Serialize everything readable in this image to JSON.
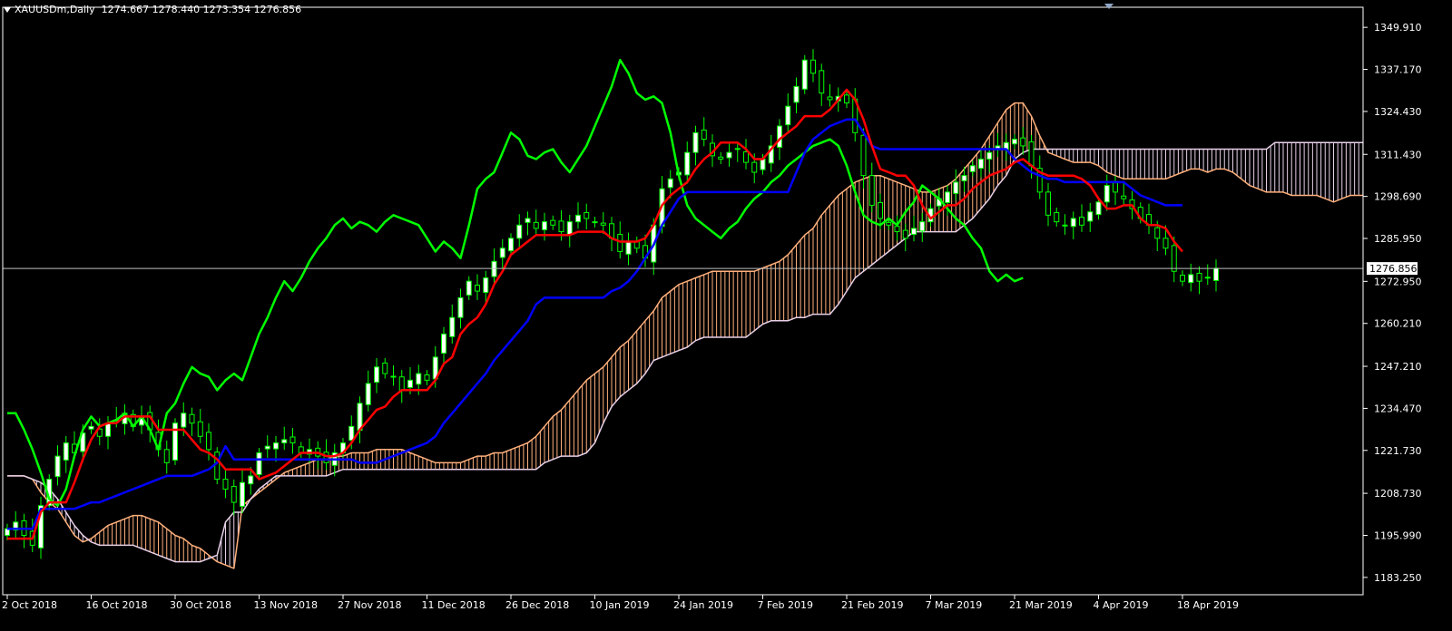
{
  "window": {
    "symbol_label": "XAUUSDm,Daily",
    "ohlc_label": "1274.667 1278.440 1273.354 1276.856"
  },
  "colors": {
    "background": "#000000",
    "axis": "#ffffff",
    "bull_candle": "#ffffff",
    "bear_candle": "#000000",
    "candle_wick": "#00ff00",
    "tenkan": "#ff0000",
    "kijun": "#0000ff",
    "chikou": "#00ff00",
    "cloud_bull": "#ffb07c",
    "cloud_bear": "#e8d0e8",
    "price_line": "#c0c0c0"
  },
  "chart_data": {
    "type": "candlestick",
    "title": "XAUUSDm,Daily",
    "indicator": "Ichimoku Kinko Hyo",
    "current_price": 1276.856,
    "current_price_label": "1276.856",
    "grid": false,
    "ylim": [
      1178.0,
      1356.0
    ],
    "y_ticks": [
      "1349.910",
      "1337.170",
      "1324.430",
      "1311.430",
      "1298.690",
      "1285.950",
      "1272.950",
      "1260.210",
      "1247.210",
      "1234.470",
      "1221.730",
      "1208.730",
      "1195.990",
      "1183.250"
    ],
    "x_ticks": [
      {
        "index": 0,
        "label": "2 Oct 2018"
      },
      {
        "index": 10,
        "label": "16 Oct 2018"
      },
      {
        "index": 20,
        "label": "30 Oct 2018"
      },
      {
        "index": 30,
        "label": "13 Nov 2018"
      },
      {
        "index": 40,
        "label": "27 Nov 2018"
      },
      {
        "index": 50,
        "label": "11 Dec 2018"
      },
      {
        "index": 60,
        "label": "26 Dec 2018"
      },
      {
        "index": 70,
        "label": "10 Jan 2019"
      },
      {
        "index": 80,
        "label": "24 Jan 2019"
      },
      {
        "index": 90,
        "label": "7 Feb 2019"
      },
      {
        "index": 100,
        "label": "21 Feb 2019"
      },
      {
        "index": 110,
        "label": "7 Mar 2019"
      },
      {
        "index": 120,
        "label": "21 Mar 2019"
      },
      {
        "index": 130,
        "label": "4 Apr 2019"
      },
      {
        "index": 140,
        "label": "18 Apr 2019"
      }
    ],
    "future_bars": 26,
    "close": [
      1198,
      1200,
      1196,
      1193,
      1205,
      1213,
      1220,
      1224,
      1221,
      1227,
      1229,
      1226,
      1230,
      1231,
      1233,
      1229,
      1232,
      1228,
      1222,
      1218,
      1230,
      1233,
      1230,
      1226,
      1222,
      1213,
      1210,
      1206,
      1212,
      1214,
      1221,
      1223,
      1224,
      1225,
      1224,
      1221,
      1222,
      1220,
      1218,
      1221,
      1224,
      1229,
      1236,
      1242,
      1247,
      1245,
      1244,
      1240,
      1243,
      1245,
      1243,
      1250,
      1257,
      1262,
      1268,
      1273,
      1270,
      1274,
      1279,
      1283,
      1286,
      1290,
      1292,
      1289,
      1291,
      1290,
      1288,
      1291,
      1293,
      1292,
      1291,
      1290,
      1286,
      1282,
      1285,
      1283,
      1280,
      1290,
      1301,
      1304,
      1306,
      1312,
      1318,
      1316,
      1311,
      1310,
      1312,
      1313,
      1309,
      1306,
      1310,
      1314,
      1320,
      1326,
      1332,
      1340,
      1336,
      1330,
      1328,
      1329,
      1327,
      1318,
      1305,
      1296,
      1292,
      1290,
      1288,
      1286,
      1289,
      1291,
      1295,
      1298,
      1300,
      1303,
      1305,
      1308,
      1310,
      1312,
      1314,
      1315,
      1316,
      1314,
      1308,
      1300,
      1293,
      1291,
      1290,
      1292,
      1290,
      1294,
      1297,
      1302,
      1300,
      1298,
      1295,
      1292,
      1290,
      1286,
      1283,
      1276,
      1273,
      1275,
      1273,
      1274,
      1276.9
    ],
    "tenkan": [
      1195,
      1195,
      1195,
      1195,
      1203,
      1206,
      1206,
      1206,
      1212,
      1219,
      1225,
      1229,
      1230,
      1230,
      1232,
      1232,
      1232,
      1232,
      1228,
      1228,
      1228,
      1228,
      1225,
      1222,
      1221,
      1219,
      1216,
      1216,
      1216,
      1216,
      1213,
      1214,
      1215,
      1217,
      1219,
      1221,
      1221,
      1221,
      1220,
      1220,
      1221,
      1224,
      1228,
      1231,
      1234,
      1235,
      1238,
      1240,
      1240,
      1240,
      1240,
      1243,
      1248,
      1250,
      1257,
      1260,
      1262,
      1266,
      1272,
      1276,
      1281,
      1283,
      1285,
      1287,
      1287,
      1287,
      1287,
      1287,
      1288,
      1288,
      1288,
      1288,
      1286,
      1285,
      1285,
      1285,
      1286,
      1290,
      1296,
      1299,
      1301,
      1303,
      1307,
      1310,
      1312,
      1315,
      1315,
      1315,
      1313,
      1310,
      1310,
      1313,
      1316,
      1318,
      1320,
      1323,
      1323,
      1323,
      1325,
      1328,
      1331,
      1328,
      1322,
      1314,
      1307,
      1306,
      1305,
      1305,
      1302,
      1296,
      1292,
      1294,
      1296,
      1296,
      1298,
      1301,
      1303,
      1305,
      1306,
      1307,
      1309,
      1310,
      1308,
      1306,
      1305,
      1305,
      1305,
      1305,
      1304,
      1302,
      1298,
      1295,
      1295,
      1296,
      1296,
      1292,
      1290,
      1290,
      1289,
      1285,
      1282
    ],
    "kijun": [
      1198,
      1198,
      1198,
      1198,
      1204,
      1204,
      1204,
      1204,
      1204,
      1205,
      1206,
      1206,
      1207,
      1208,
      1209,
      1210,
      1211,
      1212,
      1213,
      1214,
      1214,
      1214,
      1214,
      1215,
      1216,
      1218,
      1223,
      1219,
      1219,
      1219,
      1219,
      1219,
      1219,
      1219,
      1219,
      1219,
      1219,
      1219,
      1219,
      1219,
      1219,
      1219,
      1218,
      1218,
      1218,
      1219,
      1220,
      1221,
      1222,
      1223,
      1224,
      1226,
      1230,
      1233,
      1236,
      1239,
      1242,
      1245,
      1249,
      1252,
      1255,
      1258,
      1261,
      1266,
      1268,
      1268,
      1268,
      1268,
      1268,
      1268,
      1268,
      1268,
      1270,
      1271,
      1273,
      1276,
      1280,
      1284,
      1290,
      1294,
      1298,
      1300,
      1300,
      1300,
      1300,
      1300,
      1300,
      1300,
      1300,
      1300,
      1300,
      1300,
      1300,
      1300,
      1306,
      1312,
      1316,
      1318,
      1320,
      1321,
      1322,
      1322,
      1318,
      1314,
      1313,
      1313,
      1313,
      1313,
      1313,
      1313,
      1313,
      1313,
      1313,
      1313,
      1313,
      1313,
      1313,
      1313,
      1313,
      1313,
      1310,
      1308,
      1306,
      1305,
      1304,
      1304,
      1303,
      1303,
      1303,
      1303,
      1303,
      1303,
      1303,
      1303,
      1301,
      1299,
      1298,
      1297,
      1296,
      1296,
      1296
    ],
    "chikou": [
      1233,
      1233,
      1228,
      1222,
      1215,
      1207,
      1205,
      1210,
      1220,
      1228,
      1232,
      1229,
      1230,
      1231,
      1233,
      1229,
      1232,
      1228,
      1222,
      1233,
      1236,
      1242,
      1247,
      1245,
      1244,
      1240,
      1243,
      1245,
      1243,
      1250,
      1257,
      1262,
      1268,
      1273,
      1270,
      1274,
      1279,
      1283,
      1286,
      1290,
      1292,
      1289,
      1291,
      1290,
      1288,
      1291,
      1293,
      1292,
      1291,
      1290,
      1286,
      1282,
      1285,
      1283,
      1280,
      1290,
      1301,
      1304,
      1306,
      1312,
      1318,
      1316,
      1311,
      1310,
      1312,
      1313,
      1309,
      1306,
      1310,
      1314,
      1320,
      1326,
      1332,
      1340,
      1336,
      1330,
      1328,
      1329,
      1327,
      1318,
      1305,
      1296,
      1292,
      1290,
      1288,
      1286,
      1289,
      1291,
      1295,
      1298,
      1300,
      1303,
      1305,
      1308,
      1310,
      1312,
      1314,
      1315,
      1316,
      1314,
      1308,
      1300,
      1293,
      1291,
      1290,
      1292,
      1290,
      1294,
      1297,
      1302,
      1300,
      1298,
      1295,
      1292,
      1290,
      1286,
      1283,
      1276,
      1273,
      1275,
      1273,
      1274
    ],
    "span_a": [
      1214,
      1214,
      1214,
      1213,
      1209,
      1206,
      1204,
      1200,
      1196,
      1194,
      1195,
      1197,
      1199,
      1200,
      1201,
      1202,
      1202,
      1201,
      1200,
      1198,
      1196,
      1195,
      1193,
      1192,
      1190,
      1188,
      1187,
      1186,
      1205,
      1207,
      1209,
      1211,
      1213,
      1215,
      1216,
      1217,
      1218,
      1219,
      1219,
      1220,
      1220,
      1221,
      1221,
      1221,
      1222,
      1222,
      1222,
      1222,
      1221,
      1220,
      1219,
      1218,
      1218,
      1218,
      1218,
      1219,
      1220,
      1220,
      1221,
      1221,
      1222,
      1223,
      1224,
      1226,
      1229,
      1232,
      1234,
      1237,
      1240,
      1243,
      1245,
      1247,
      1250,
      1253,
      1255,
      1258,
      1261,
      1264,
      1268,
      1270,
      1272,
      1273,
      1274,
      1275,
      1276,
      1276,
      1276,
      1276,
      1276,
      1276,
      1277,
      1278,
      1279,
      1281,
      1284,
      1287,
      1289,
      1293,
      1296,
      1299,
      1301,
      1303,
      1304,
      1305,
      1305,
      1304,
      1303,
      1302,
      1301,
      1300,
      1300,
      1301,
      1302,
      1304,
      1307,
      1310,
      1313,
      1317,
      1321,
      1325,
      1327,
      1327,
      1323,
      1317,
      1312,
      1311,
      1310,
      1309,
      1309,
      1309,
      1308,
      1306,
      1305,
      1304,
      1304,
      1304,
      1304,
      1304,
      1304,
      1305,
      1306,
      1307,
      1307,
      1306,
      1307,
      1307,
      1306,
      1304,
      1302,
      1301,
      1300,
      1300,
      1300,
      1299,
      1299,
      1299,
      1299,
      1298,
      1297,
      1298,
      1299,
      1299,
      1299,
      1298,
      1297,
      1296
    ],
    "span_b": [
      1214,
      1214,
      1214,
      1213,
      1212,
      1210,
      1207,
      1203,
      1199,
      1196,
      1194,
      1193,
      1193,
      1193,
      1193,
      1193,
      1192,
      1191,
      1190,
      1189,
      1188,
      1188,
      1188,
      1188,
      1189,
      1190,
      1200,
      1203,
      1203,
      1207,
      1210,
      1212,
      1214,
      1214,
      1214,
      1214,
      1214,
      1214,
      1214,
      1215,
      1216,
      1216,
      1216,
      1216,
      1216,
      1216,
      1216,
      1216,
      1216,
      1216,
      1216,
      1216,
      1216,
      1216,
      1216,
      1216,
      1216,
      1216,
      1216,
      1216,
      1216,
      1216,
      1216,
      1216,
      1218,
      1219,
      1220,
      1220,
      1220,
      1221,
      1224,
      1230,
      1235,
      1238,
      1240,
      1242,
      1245,
      1249,
      1250,
      1251,
      1252,
      1253,
      1255,
      1256,
      1256,
      1256,
      1256,
      1256,
      1256,
      1258,
      1260,
      1261,
      1261,
      1261,
      1262,
      1262,
      1263,
      1263,
      1263,
      1266,
      1270,
      1274,
      1276,
      1278,
      1280,
      1282,
      1284,
      1286,
      1288,
      1288,
      1288,
      1288,
      1288,
      1288,
      1290,
      1292,
      1295,
      1298,
      1302,
      1305,
      1310,
      1312,
      1313,
      1313,
      1313,
      1313,
      1313,
      1313,
      1313,
      1313,
      1313,
      1313,
      1313,
      1313,
      1313,
      1313,
      1313,
      1313,
      1313,
      1313,
      1313,
      1313,
      1313,
      1313,
      1313,
      1313,
      1313,
      1313,
      1313,
      1313,
      1313,
      1315,
      1315,
      1315,
      1315,
      1315,
      1315,
      1315,
      1315,
      1315,
      1315,
      1315,
      1315,
      1315,
      1315,
      1315,
      1309,
      1309
    ]
  }
}
